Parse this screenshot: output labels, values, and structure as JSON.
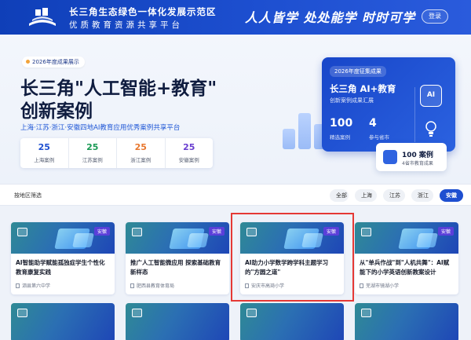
{
  "header": {
    "org_line1": "长三角生态绿色一体化发展示范区",
    "org_line2": "优质教育资源共享平台",
    "slogan": "人人皆学 处处能学 时时可学",
    "login_label": "登录"
  },
  "hero": {
    "badge": "2026年度成果展示",
    "title_line1": "长三角\"人工智能+教育\"",
    "title_line2": "创新案例",
    "subtitle": "上海·江苏·浙江·安徽四地AI教育应用优秀案例共享平台",
    "stats": [
      {
        "value": "25",
        "label": "上海案例",
        "color": "#1e4fd0"
      },
      {
        "value": "25",
        "label": "江苏案例",
        "color": "#1a9a55"
      },
      {
        "value": "25",
        "label": "浙江案例",
        "color": "#e8772e"
      },
      {
        "value": "25",
        "label": "安徽案例",
        "color": "#6a3fd0"
      }
    ],
    "feature_card": {
      "tag": "2026年度征集成果",
      "heading": "长三角 AI+教育",
      "sub": "创新案例成果汇展",
      "stat1_value": "100",
      "stat1_label": "精选案例",
      "stat2_value": "4",
      "stat2_label": "参与省市",
      "ai_label": "AI"
    },
    "float_card": {
      "title": "100 案例",
      "sub": "4省市教育成果"
    }
  },
  "filter": {
    "label": "按地区筛选",
    "chips": [
      "全部",
      "上海",
      "江苏",
      "浙江",
      "安徽"
    ],
    "active": "安徽"
  },
  "cards": [
    {
      "tag": "安徽",
      "title": "AI智能助学赋能孤独症学生个性化教育康复实践",
      "school": "泗县第六中学"
    },
    {
      "tag": "安徽",
      "title": "推广人工智能微应用 探索基础教育新样态",
      "school": "肥西县教育体育局"
    },
    {
      "tag": "安徽",
      "title": "AI助力小学数学跨学科主题学习的\"方圆之道\"",
      "school": "安庆市高琦小学"
    },
    {
      "tag": "安徽",
      "title": "从\"单兵作战\"到\"人机共舞\"：AI赋能下的小学英语创新教案设计",
      "school": "芜湖市镜湖小学"
    }
  ]
}
